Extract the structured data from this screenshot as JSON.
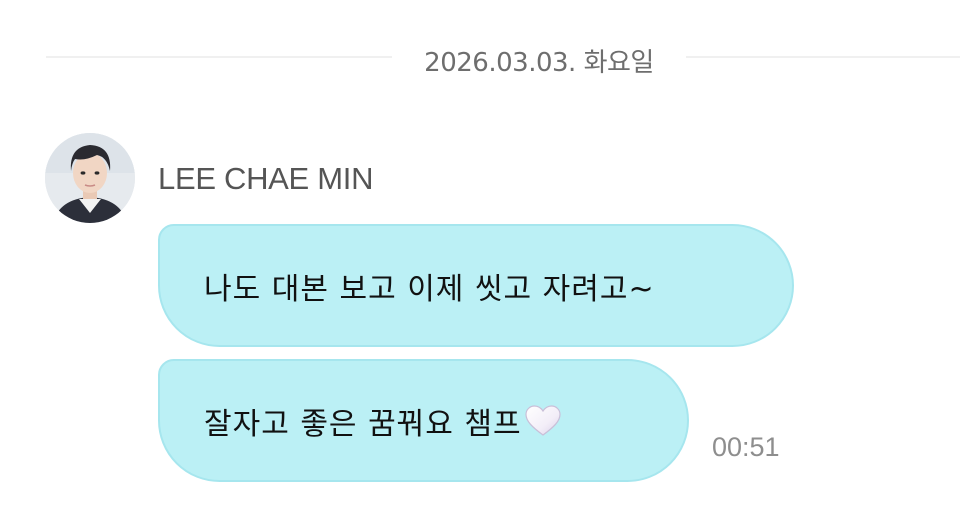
{
  "date_divider": {
    "label": "2026.03.03. 화요일"
  },
  "sender": {
    "name": "LEE CHAE MIN",
    "avatar_icon": "profile-photo"
  },
  "messages": [
    {
      "text": "나도 대본 보고 이제 씻고 자려고~"
    },
    {
      "text": "잘자고 좋은 꿈꿔요 챔프",
      "emoji": "white-heart-icon",
      "time": "00:51"
    }
  ],
  "colors": {
    "bubble_bg": "#bbf0f5",
    "bubble_border": "#a6e6ee",
    "background": "#ffffff",
    "divider": "#f0f0f0"
  }
}
